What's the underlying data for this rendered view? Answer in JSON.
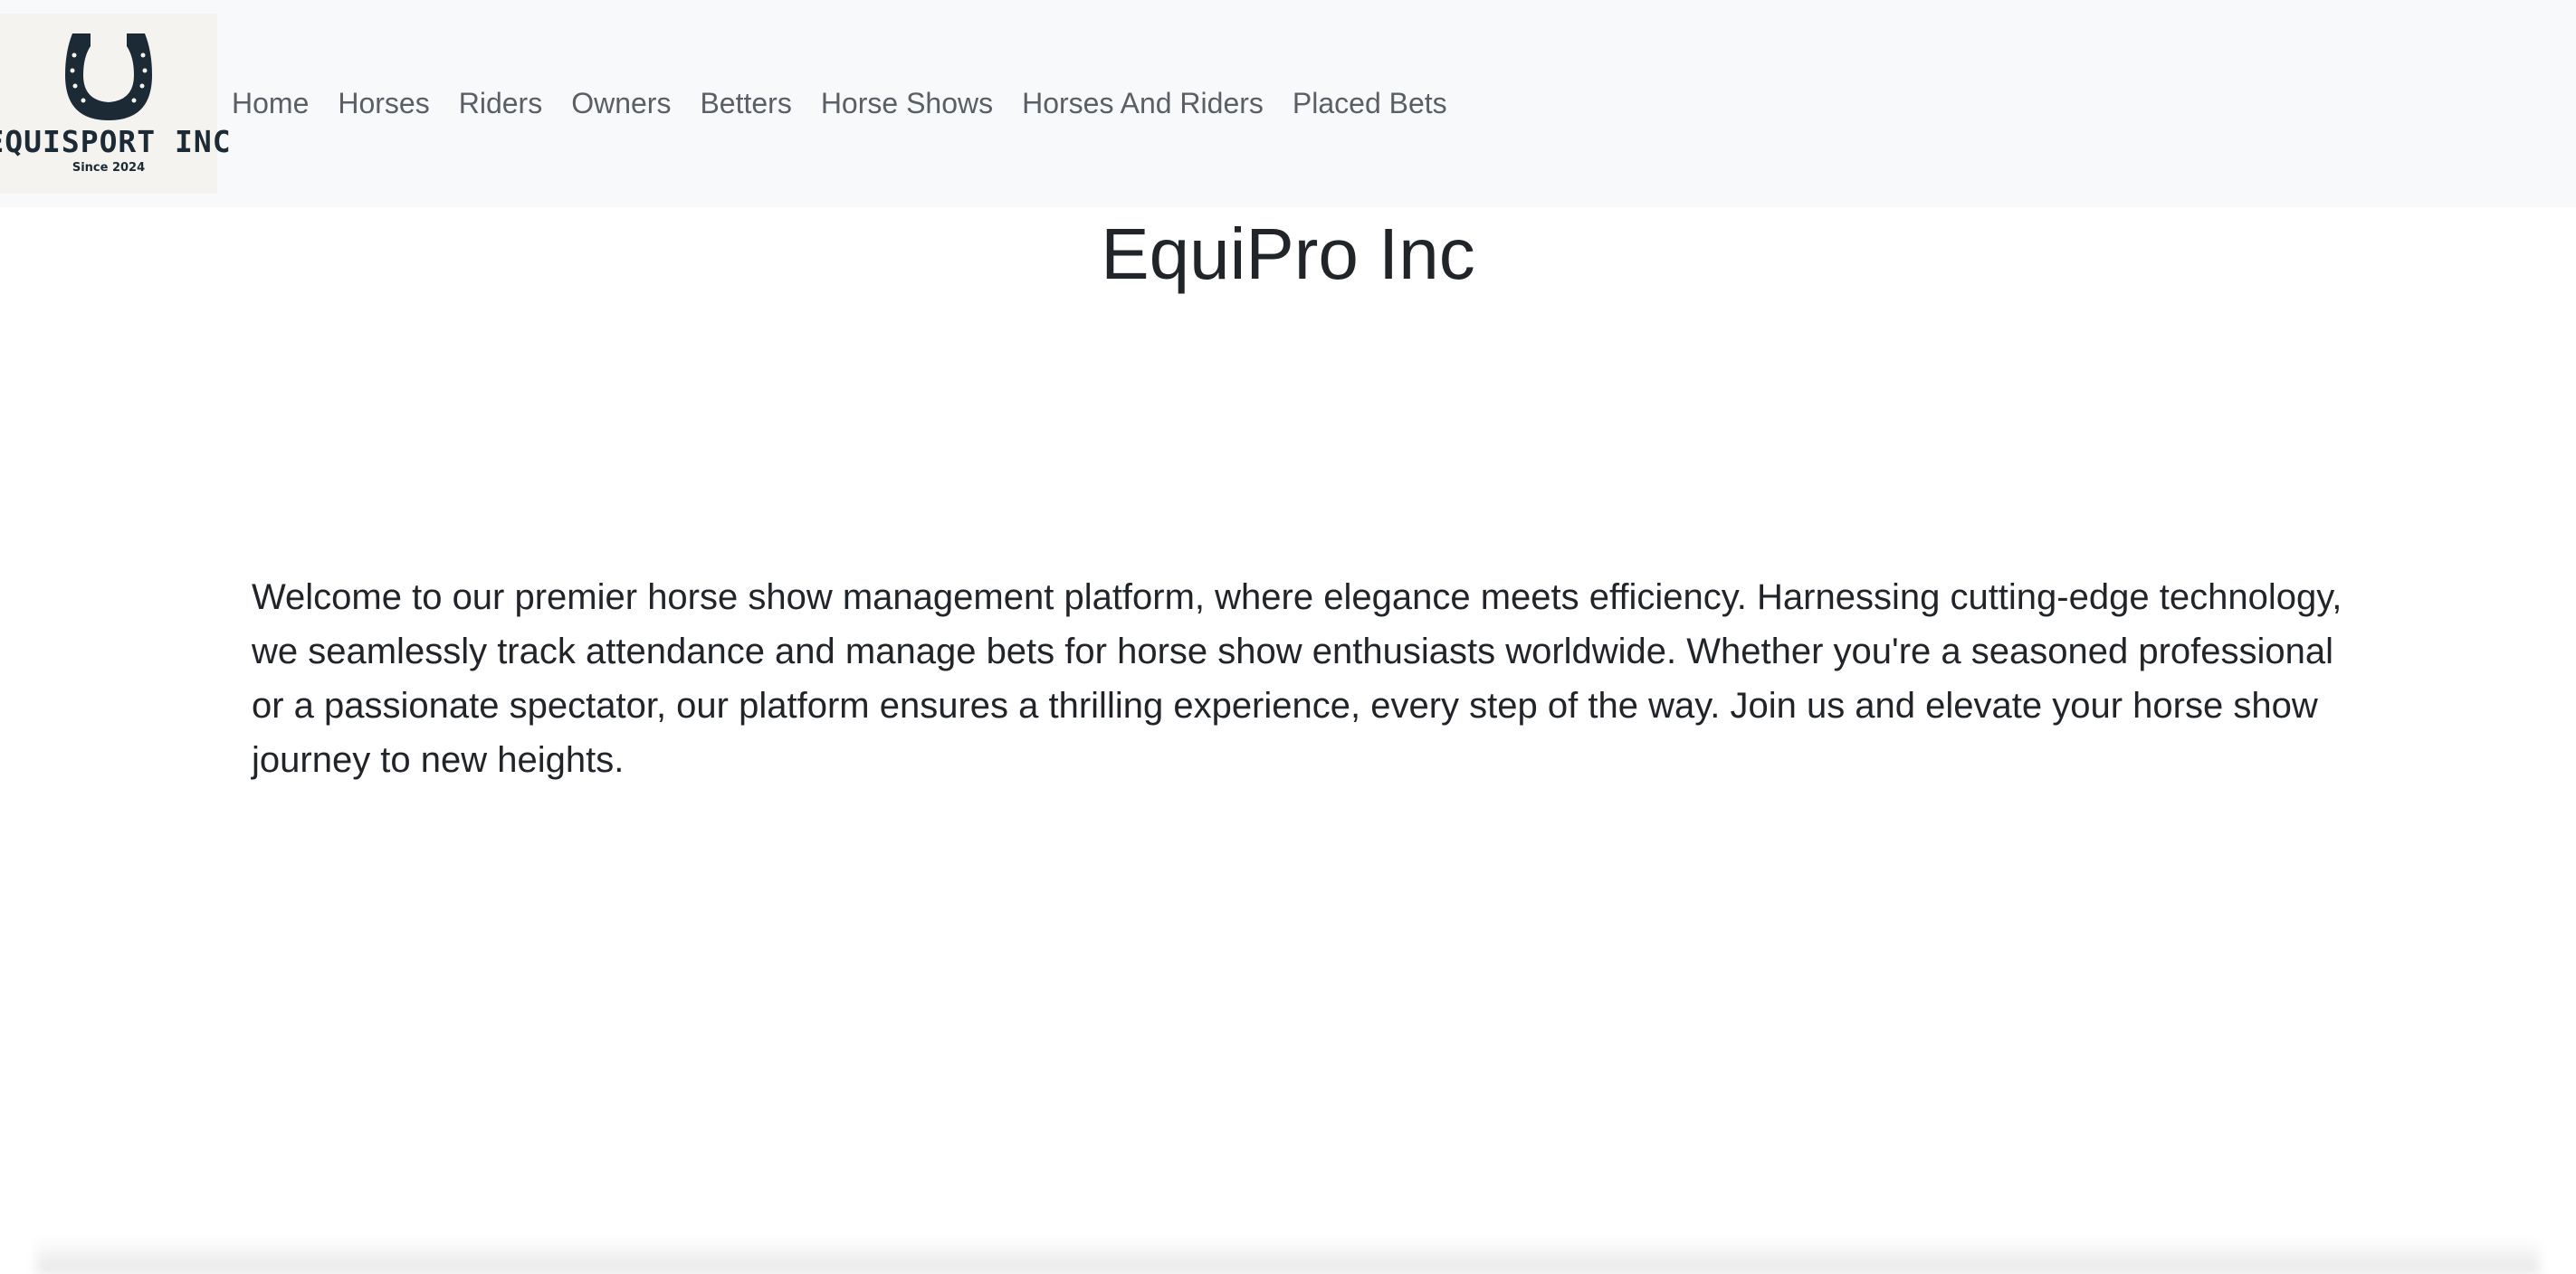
{
  "navbar": {
    "logo": {
      "icon": "horseshoe-icon",
      "name": "EQUISPORT INC",
      "tagline": "Since 2024"
    },
    "links": [
      {
        "label": "Home"
      },
      {
        "label": "Horses"
      },
      {
        "label": "Riders"
      },
      {
        "label": "Owners"
      },
      {
        "label": "Betters"
      },
      {
        "label": "Horse Shows"
      },
      {
        "label": "Horses And Riders"
      },
      {
        "label": "Placed Bets"
      }
    ]
  },
  "main": {
    "title": "EquiPro Inc",
    "intro": "Welcome to our premier horse show management platform, where elegance meets efficiency. Harnessing cutting-edge technology, we seamlessly track attendance and manage bets for horse show enthusiasts worldwide. Whether you're a seasoned professional or a passionate spectator, our platform ensures a thrilling experience, every step of the way. Join us and elevate your horse show journey to new heights."
  },
  "colors": {
    "navbar_bg": "#f8f9fa",
    "nav_link": "#5a5f66",
    "text": "#212529",
    "logo_dark": "#1b2a35"
  }
}
